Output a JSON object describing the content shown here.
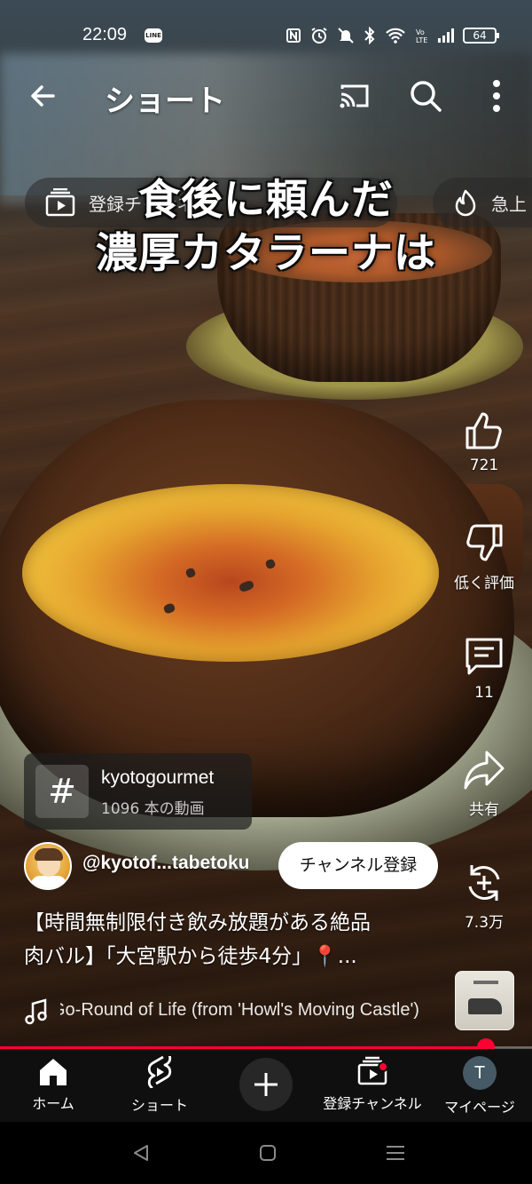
{
  "status_bar": {
    "time": "22:09",
    "app_icon": "LINE",
    "battery": "64",
    "icons": [
      "nfc-icon",
      "alarm-icon",
      "mute-icon",
      "bluetooth-icon",
      "wifi-icon",
      "volte-icon",
      "signal-icon",
      "battery-icon"
    ]
  },
  "header": {
    "title": "ショート",
    "icons": [
      "back-arrow-icon",
      "cast-icon",
      "search-icon",
      "more-vertical-icon"
    ]
  },
  "chips": [
    {
      "label": "登録チャンネル",
      "icon": "subscriptions-icon"
    },
    {
      "label": "急上",
      "icon": "trending-icon"
    }
  ],
  "video": {
    "caption_line1": "食後に頼んだ",
    "caption_line2": "濃厚カタラーナは"
  },
  "actions": {
    "like_count": "721",
    "dislike_label": "低く評価",
    "comment_count": "11",
    "share_label": "共有",
    "remix_count": "7.3万"
  },
  "hashtag": {
    "name": "kyotogourmet",
    "count": "1096 本の動画"
  },
  "channel": {
    "handle": "@kyotof...tabetoku",
    "subscribe_label": "チャンネル登録"
  },
  "description": {
    "line1": "【時間無制限付き飲み放題がある絶品",
    "line2": "肉バル】「大宮駅から徒歩4分」📍..."
  },
  "music": {
    "title": "Go-Round of Life (from 'Howl's Moving Castle')"
  },
  "progress": {
    "fraction": 0.913
  },
  "bottom_nav": {
    "home": "ホーム",
    "shorts": "ショート",
    "subscriptions": "登録チャンネル",
    "you": "マイページ",
    "avatar_letter": "T"
  },
  "colors": {
    "accent": "#ff0033",
    "nav_bg": "#0f0f0f"
  }
}
